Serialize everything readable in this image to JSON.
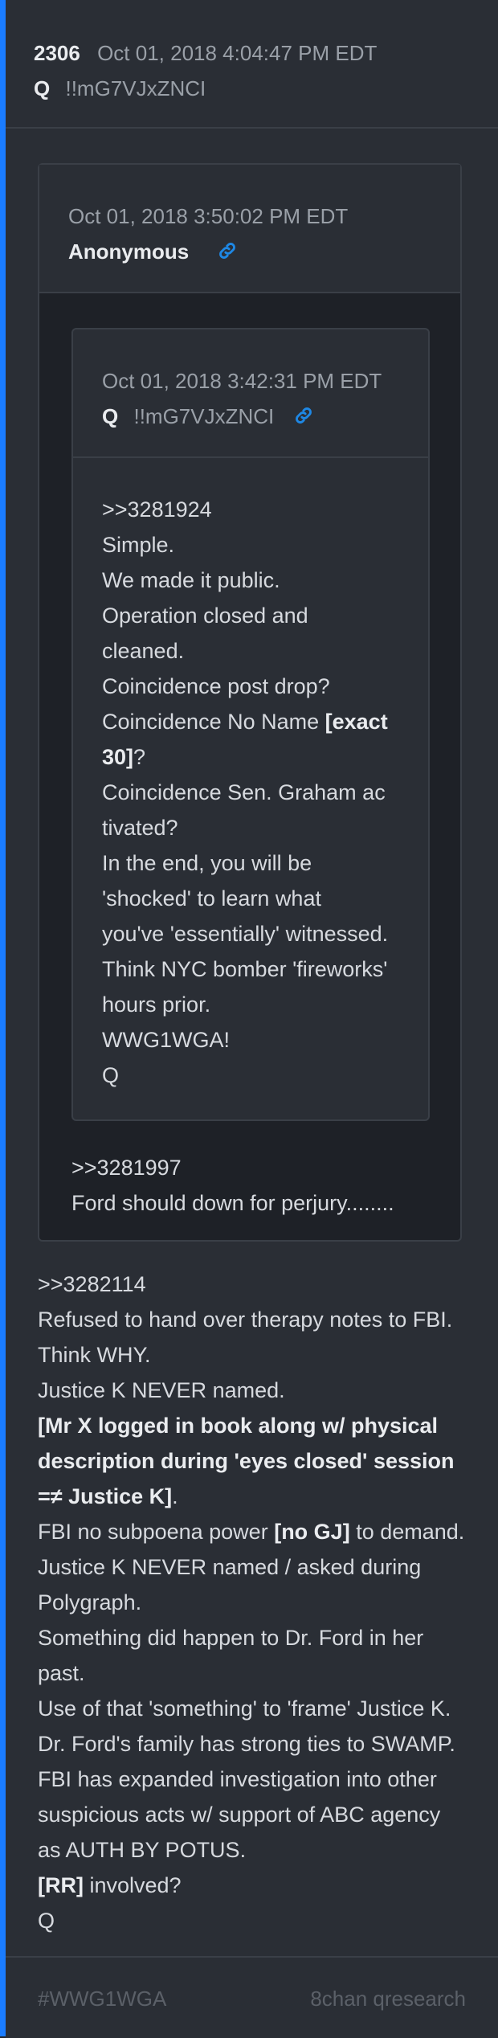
{
  "post": {
    "number": "2306",
    "date": "Oct 01, 2018 4:04:47 PM EDT",
    "author": "Q",
    "trip": "!!mG7VJxZNCI"
  },
  "outer_quote": {
    "date": "Oct 01, 2018 3:50:02 PM EDT",
    "author": "Anonymous",
    "link_icon": "link-icon",
    "body": [
      ">>3281997",
      "Ford should down for perjury........"
    ]
  },
  "inner_quote": {
    "date": "Oct 01, 2018 3:42:31 PM EDT",
    "author": "Q",
    "trip": "!!mG7VJxZNCI",
    "link_icon": "link-icon",
    "lines": {
      "l1": ">>3281924",
      "l2": "Simple.",
      "l3": "We made it public.",
      "l4": "Operation closed and",
      "l5": "cleaned.",
      "l6": "Coincidence post drop?",
      "l7a": "Coincidence No Name ",
      "l7b": "[exact",
      "l8a": "30]",
      "l8b": "?",
      "l9": "Coincidence Sen. Graham ac",
      "l10": "tivated?",
      "l11": "In the end, you will be",
      "l12": "'shocked' to learn what",
      "l13": "you've 'essentially' witnessed.",
      "l14": "Think NYC bomber 'fireworks'",
      "l15": "hours prior.",
      "l16": "WWG1WGA!",
      "l17": "Q"
    }
  },
  "main": {
    "l1": ">>3282114",
    "l2": "Refused to hand over therapy notes to FBI.",
    "l3": "Think WHY.",
    "l4": "Justice K NEVER named.",
    "l5": "[Mr X logged in book along w/ physical",
    "l6": "description during 'eyes closed' session",
    "l7a": "=≠ Justice K]",
    "l7b": ".",
    "l8a": "FBI no subpoena power ",
    "l8b": "[no GJ]",
    "l8c": " to demand.",
    "l9": "Justice K NEVER named / asked during",
    "l10": "Polygraph.",
    "l11": "Something did happen to Dr. Ford in her",
    "l12": "past.",
    "l13": "Use of that 'something' to 'frame' Justice K.",
    "l14": "Dr. Ford's family has strong ties to SWAMP.",
    "l15": "FBI has expanded investigation into other",
    "l16": "suspicious acts w/ support of ABC agency",
    "l17": "as AUTH BY POTUS.",
    "l18a": "[RR]",
    "l18b": " involved?",
    "l19": "Q"
  },
  "footer": {
    "tag": "#WWG1WGA",
    "board": "8chan qresearch"
  }
}
